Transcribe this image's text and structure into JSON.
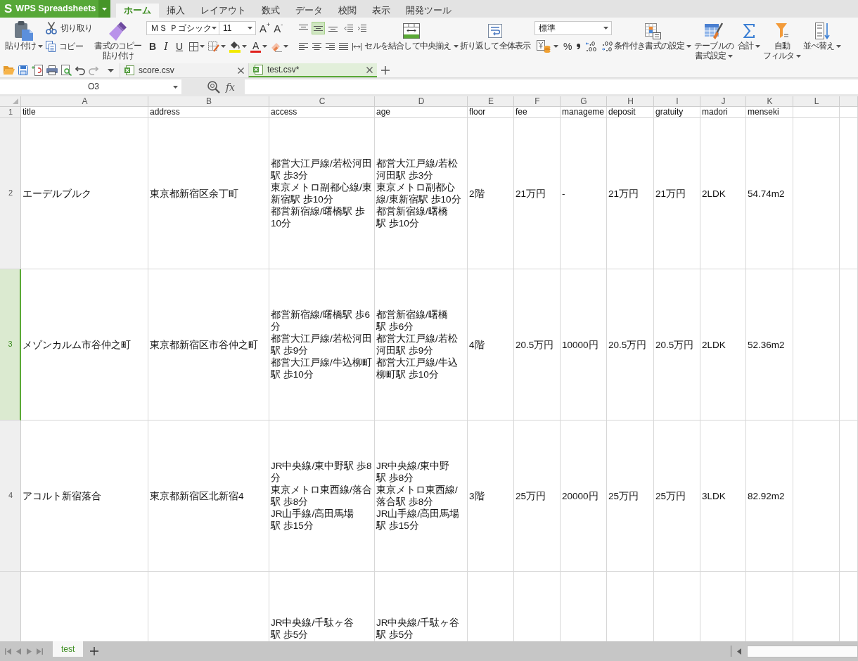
{
  "app_menu": {
    "logo": "S",
    "label": "WPS Spreadsheets"
  },
  "ribbon_tabs": [
    {
      "label": "ホーム",
      "selected": true
    },
    {
      "label": "挿入",
      "selected": false
    },
    {
      "label": "レイアウト",
      "selected": false
    },
    {
      "label": "数式",
      "selected": false
    },
    {
      "label": "データ",
      "selected": false
    },
    {
      "label": "校閲",
      "selected": false
    },
    {
      "label": "表示",
      "selected": false
    },
    {
      "label": "開発ツール",
      "selected": false
    }
  ],
  "ribbon": {
    "paste": "貼り付け",
    "cut": "切り取り",
    "copy": "コピー",
    "format_painter": [
      "書式のコピー",
      "貼り付け"
    ],
    "font_name": "ＭＳ Ｐゴシック",
    "font_size": "11",
    "font_size_steps": [
      "A$^{+}$",
      "A$^{-}$"
    ],
    "font_styles": [
      "B",
      "I",
      "U"
    ],
    "font_color": "A",
    "vertical_align": [
      {
        "selected": false
      },
      {
        "selected": true
      },
      {
        "selected": false
      }
    ],
    "merge": "セルを結合して中央揃え",
    "wrap": "折り返して全体表示",
    "number_format": "標準",
    "percent": "%",
    "conditional_format": "条件付き書式の設定",
    "table_format": [
      "テーブルの",
      "書式設定"
    ],
    "sum": "合計",
    "filter": [
      "自動",
      "フィルタ"
    ],
    "sort": "並べ替え"
  },
  "document_tabs": [
    {
      "label": "score.csv",
      "selected": false
    },
    {
      "label": "test.csv*",
      "selected": true
    }
  ],
  "formula_bar": {
    "name_box": "O3",
    "function_label": "fx"
  },
  "sheet": {
    "columns": [
      "A",
      "B",
      "C",
      "D",
      "E",
      "F",
      "G",
      "H",
      "I",
      "J",
      "K",
      "L"
    ],
    "rows": [
      {
        "number": "1",
        "selected": false,
        "cells": [
          "title",
          "address",
          "access",
          "age",
          "floor",
          "fee",
          "manageme",
          "deposit",
          "gratuity",
          "madori",
          "menseki"
        ]
      },
      {
        "number": "2",
        "selected": false,
        "cells": [
          "エーデルブルク",
          "東京都新宿区余丁町",
          [
            "都営大江戸線/若松河田駅 歩3分",
            "東京メトロ副都心線/東新宿駅 歩10分",
            "都営新宿線/曙橋駅 歩10分"
          ],
          [
            "都営大江戸線/若松河田駅 歩3分",
            "東京メトロ副都心線/東新宿駅 歩10分",
            "都営新宿線/曙橋駅 歩10分"
          ],
          "2階",
          "21万円",
          "-",
          "21万円",
          "21万円",
          "2LDK",
          "54.74m2"
        ]
      },
      {
        "number": "3",
        "selected": true,
        "cells": [
          "メゾンカルム市谷仲之町",
          "東京都新宿区市谷仲之町",
          [
            "都営新宿線/曙橋駅 歩6分",
            "都営大江戸線/若松河田駅 歩9分",
            "都営大江戸線/牛込柳町駅 歩10分"
          ],
          [
            "都営新宿線/曙橋駅 歩6分",
            "都営大江戸線/若松河田駅 歩9分",
            "都営大江戸線/牛込柳町駅 歩10分"
          ],
          "4階",
          "20.5万円",
          "10000円",
          "20.5万円",
          "20.5万円",
          "2LDK",
          "52.36m2"
        ]
      },
      {
        "number": "4",
        "selected": false,
        "cells": [
          "アコルト新宿落合",
          "東京都新宿区北新宿4",
          [
            "JR中央線/東中野駅 歩8分",
            "東京メトロ東西線/落合駅 歩8分",
            "JR山手線/高田馬場駅 歩15分"
          ],
          [
            "JR中央線/東中野駅 歩8分",
            "東京メトロ東西線/落合駅 歩8分",
            "JR山手線/高田馬場駅 歩15分"
          ],
          "3階",
          "25万円",
          "20000円",
          "25万円",
          "25万円",
          "3LDK",
          "82.92m2"
        ]
      }
    ],
    "cut_off_row": {
      "access": "JR中央線/千駄ヶ谷駅 歩5分",
      "age": "JR中央線/千駄ヶ谷駅 歩5分"
    }
  },
  "sheet_tabs": [
    {
      "label": "test",
      "selected": true
    }
  ]
}
